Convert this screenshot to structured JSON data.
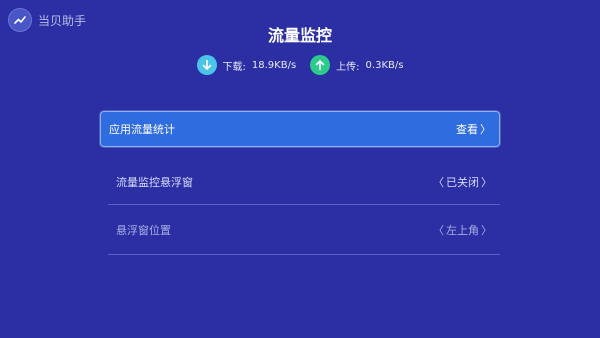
{
  "brand": {
    "name": "当贝助手"
  },
  "header": {
    "title": "流量监控"
  },
  "speeds": {
    "download": {
      "label": "下载:",
      "value": "18.9KB/s"
    },
    "upload": {
      "label": "上传:",
      "value": "0.3KB/s"
    }
  },
  "settings": [
    {
      "label": "应用流量统计",
      "value": "查看",
      "prefix": "",
      "suffix": "〉"
    },
    {
      "label": "流量监控悬浮窗",
      "value": "已关闭",
      "prefix": "〈",
      "suffix": "〉"
    },
    {
      "label": "悬浮窗位置",
      "value": "左上角",
      "prefix": "〈",
      "suffix": "〉"
    }
  ],
  "colors": {
    "background": "#2b2fa3",
    "focus": "#2f6ce0",
    "download": "#4cc4ea",
    "upload": "#2ec98c"
  }
}
